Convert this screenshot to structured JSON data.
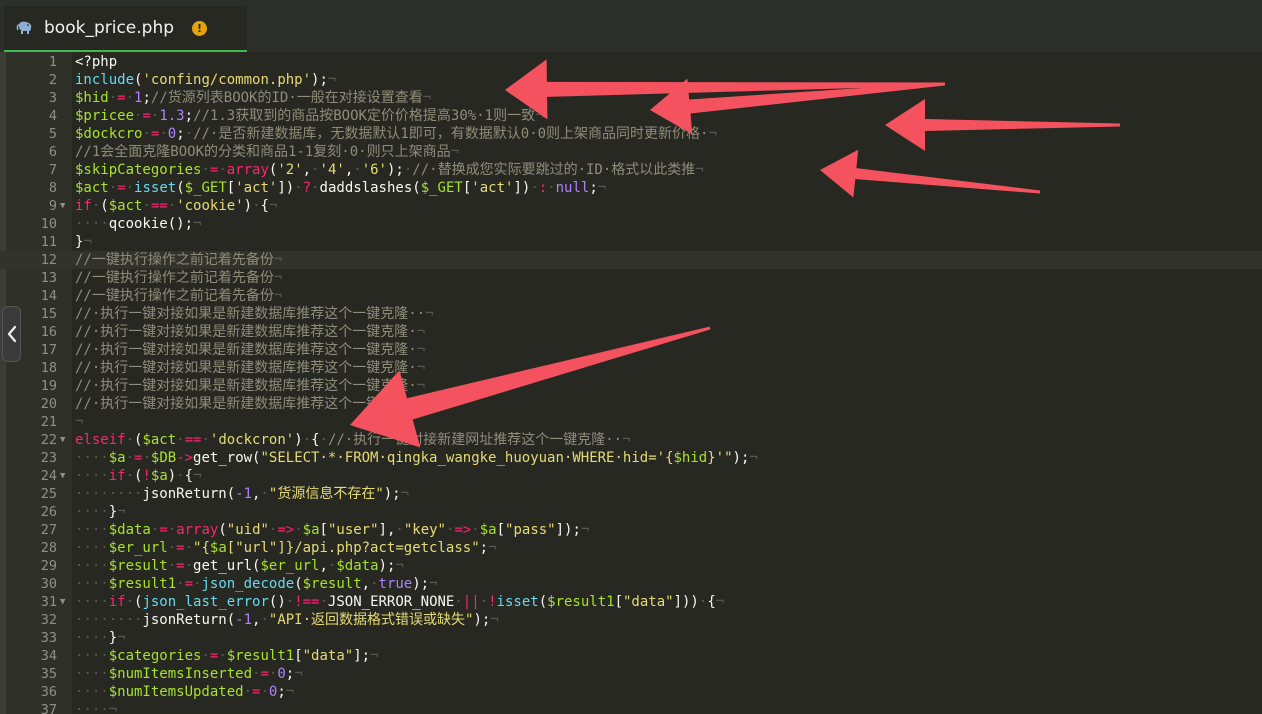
{
  "tab": {
    "icon": "php-elephant-icon",
    "title": "book_price.php",
    "warning_icon": "warning-icon",
    "warning_glyph": "!"
  },
  "side_handle": {
    "icon": "chevron-left-icon"
  },
  "editor": {
    "active_line": 12,
    "whitespace_marker": "¬",
    "lines": [
      {
        "n": "1",
        "t": [
          [
            "",
            "<?php"
          ]
        ]
      },
      {
        "n": "2",
        "t": [
          [
            "f",
            "include"
          ],
          [
            "",
            "("
          ],
          [
            "s",
            "'confing/common.php'"
          ],
          [
            "",
            ");"
          ],
          [
            "w",
            "¬"
          ]
        ]
      },
      {
        "n": "3",
        "t": [
          [
            "v",
            "$hid"
          ],
          [
            "w",
            "·"
          ],
          [
            "o",
            "="
          ],
          [
            "w",
            "·"
          ],
          [
            "n",
            "1"
          ],
          [
            "",
            ";"
          ],
          [
            "c",
            "//货源列表BOOK的ID·一般在对接设置查看"
          ],
          [
            "w",
            "¬"
          ]
        ]
      },
      {
        "n": "4",
        "t": [
          [
            "v",
            "$pricee"
          ],
          [
            "w",
            "·"
          ],
          [
            "o",
            "="
          ],
          [
            "w",
            "·"
          ],
          [
            "n",
            "1.3"
          ],
          [
            "",
            ";"
          ],
          [
            "c",
            "//1.3获取到的商品按BOOK定价价格提高30%·1则一致"
          ],
          [
            "w",
            "¬"
          ]
        ]
      },
      {
        "n": "5",
        "t": [
          [
            "v",
            "$dockcro"
          ],
          [
            "w",
            "·"
          ],
          [
            "o",
            "="
          ],
          [
            "w",
            "·"
          ],
          [
            "n",
            "0"
          ],
          [
            "",
            ";"
          ],
          [
            "w",
            "·"
          ],
          [
            "c",
            "//·是否新建数据库，无数据默认1即可，有数据默认0·0则上架商品同时更新价格·"
          ],
          [
            "w",
            "¬"
          ]
        ]
      },
      {
        "n": "6",
        "t": [
          [
            "c",
            "//1会全面克隆BOOK的分类和商品1-1复刻·0·则只上架商品"
          ],
          [
            "w",
            "¬"
          ]
        ]
      },
      {
        "n": "7",
        "t": [
          [
            "v",
            "$skipCategories"
          ],
          [
            "w",
            "·"
          ],
          [
            "o",
            "="
          ],
          [
            "w",
            "·"
          ],
          [
            "k",
            "array"
          ],
          [
            "",
            "("
          ],
          [
            "s",
            "'2'"
          ],
          [
            "",
            ","
          ],
          [
            "w",
            "·"
          ],
          [
            "s",
            "'4'"
          ],
          [
            "",
            ","
          ],
          [
            "w",
            "·"
          ],
          [
            "s",
            "'6'"
          ],
          [
            "",
            ");"
          ],
          [
            "w",
            "·"
          ],
          [
            "c",
            "//·替换成您实际要跳过的·ID·格式以此类推"
          ],
          [
            "w",
            "¬"
          ]
        ]
      },
      {
        "n": "8",
        "t": [
          [
            "v",
            "$act"
          ],
          [
            "w",
            "·"
          ],
          [
            "o",
            "="
          ],
          [
            "w",
            "·"
          ],
          [
            "f",
            "isset"
          ],
          [
            "",
            "("
          ],
          [
            "v",
            "$_GET"
          ],
          [
            "",
            "["
          ],
          [
            "s",
            "'act'"
          ],
          [
            "",
            "])"
          ],
          [
            "w",
            "·"
          ],
          [
            "o",
            "?"
          ],
          [
            "w",
            "·"
          ],
          [
            "",
            "daddslashes("
          ],
          [
            "v",
            "$_GET"
          ],
          [
            "",
            "["
          ],
          [
            "s",
            "'act'"
          ],
          [
            "",
            "])"
          ],
          [
            "w",
            "·"
          ],
          [
            "o",
            ":"
          ],
          [
            "w",
            "·"
          ],
          [
            "n",
            "null"
          ],
          [
            "",
            ";"
          ],
          [
            "w",
            "¬"
          ]
        ]
      },
      {
        "n": "9",
        "fold": true,
        "t": [
          [
            "k",
            "if"
          ],
          [
            "w",
            "·"
          ],
          [
            "",
            "("
          ],
          [
            "v",
            "$act"
          ],
          [
            "w",
            "·"
          ],
          [
            "o",
            "=="
          ],
          [
            "w",
            "·"
          ],
          [
            "s",
            "'cookie'"
          ],
          [
            "",
            ")"
          ],
          [
            "w",
            "·"
          ],
          [
            "",
            "{"
          ],
          [
            "w",
            "¬"
          ]
        ]
      },
      {
        "n": "10",
        "t": [
          [
            "w",
            "····"
          ],
          [
            "",
            "qcookie();"
          ],
          [
            "w",
            "¬"
          ]
        ]
      },
      {
        "n": "11",
        "t": [
          [
            "",
            "}"
          ],
          [
            "w",
            "¬"
          ]
        ]
      },
      {
        "n": "12",
        "t": [
          [
            "c",
            "//一键执行操作之前记着先备份"
          ],
          [
            "w",
            "¬"
          ]
        ]
      },
      {
        "n": "13",
        "t": [
          [
            "c",
            "//一键执行操作之前记着先备份"
          ],
          [
            "w",
            "¬"
          ]
        ]
      },
      {
        "n": "14",
        "t": [
          [
            "c",
            "//一键执行操作之前记着先备份"
          ],
          [
            "w",
            "¬"
          ]
        ]
      },
      {
        "n": "15",
        "t": [
          [
            "c",
            "//·执行一键对接如果是新建数据库推荐这个一键克隆··"
          ],
          [
            "w",
            "¬"
          ]
        ]
      },
      {
        "n": "16",
        "t": [
          [
            "c",
            "//·执行一键对接如果是新建数据库推荐这个一键克隆·"
          ],
          [
            "w",
            "¬"
          ]
        ]
      },
      {
        "n": "17",
        "t": [
          [
            "c",
            "//·执行一键对接如果是新建数据库推荐这个一键克隆·"
          ],
          [
            "w",
            "¬"
          ]
        ]
      },
      {
        "n": "18",
        "t": [
          [
            "c",
            "//·执行一键对接如果是新建数据库推荐这个一键克隆·"
          ],
          [
            "w",
            "¬"
          ]
        ]
      },
      {
        "n": "19",
        "t": [
          [
            "c",
            "//·执行一键对接如果是新建数据库推荐这个一键克隆·"
          ],
          [
            "w",
            "¬"
          ]
        ]
      },
      {
        "n": "20",
        "t": [
          [
            "c",
            "//·执行一键对接如果是新建数据库推荐这个一键克隆·"
          ],
          [
            "w",
            "¬"
          ]
        ]
      },
      {
        "n": "21",
        "t": [
          [
            "w",
            "¬"
          ]
        ]
      },
      {
        "n": "22",
        "fold": true,
        "t": [
          [
            "k",
            "elseif"
          ],
          [
            "w",
            "·"
          ],
          [
            "",
            "("
          ],
          [
            "v",
            "$act"
          ],
          [
            "w",
            "·"
          ],
          [
            "o",
            "=="
          ],
          [
            "w",
            "·"
          ],
          [
            "s",
            "'dockcron'"
          ],
          [
            "",
            ")"
          ],
          [
            "w",
            "·"
          ],
          [
            "",
            "{"
          ],
          [
            "w",
            "·"
          ],
          [
            "c",
            "//·执行一键对接新建网址推荐这个一键克隆··"
          ],
          [
            "w",
            "¬"
          ]
        ]
      },
      {
        "n": "23",
        "t": [
          [
            "w",
            "····"
          ],
          [
            "v",
            "$a"
          ],
          [
            "w",
            "·"
          ],
          [
            "o",
            "="
          ],
          [
            "w",
            "·"
          ],
          [
            "v",
            "$DB"
          ],
          [
            "o",
            "->"
          ],
          [
            "",
            "get_row("
          ],
          [
            "s",
            "\"SELECT·*·FROM·qingka_wangke_huoyuan·WHERE·hid='{"
          ],
          [
            "v",
            "$hid"
          ],
          [
            "s",
            "}'\""
          ],
          [
            "",
            ");"
          ],
          [
            "w",
            "¬"
          ]
        ]
      },
      {
        "n": "24",
        "fold": true,
        "t": [
          [
            "w",
            "····"
          ],
          [
            "k",
            "if"
          ],
          [
            "w",
            "·"
          ],
          [
            "",
            "("
          ],
          [
            "o",
            "!"
          ],
          [
            "v",
            "$a"
          ],
          [
            "",
            ")"
          ],
          [
            "w",
            "·"
          ],
          [
            "",
            "{"
          ],
          [
            "w",
            "¬"
          ]
        ]
      },
      {
        "n": "25",
        "t": [
          [
            "w",
            "········"
          ],
          [
            "",
            "jsonReturn("
          ],
          [
            "n",
            "-1"
          ],
          [
            "",
            ","
          ],
          [
            "w",
            "·"
          ],
          [
            "s",
            "\"货源信息不存在\""
          ],
          [
            "",
            ");"
          ],
          [
            "w",
            "¬"
          ]
        ]
      },
      {
        "n": "26",
        "t": [
          [
            "w",
            "····"
          ],
          [
            "",
            "}"
          ],
          [
            "w",
            "¬"
          ]
        ]
      },
      {
        "n": "27",
        "t": [
          [
            "w",
            "····"
          ],
          [
            "v",
            "$data"
          ],
          [
            "w",
            "·"
          ],
          [
            "o",
            "="
          ],
          [
            "w",
            "·"
          ],
          [
            "k",
            "array"
          ],
          [
            "",
            "("
          ],
          [
            "s",
            "\"uid\""
          ],
          [
            "w",
            "·"
          ],
          [
            "o",
            "=>"
          ],
          [
            "w",
            "·"
          ],
          [
            "v",
            "$a"
          ],
          [
            "",
            "["
          ],
          [
            "s",
            "\"user\""
          ],
          [
            "",
            "],"
          ],
          [
            "w",
            "·"
          ],
          [
            "s",
            "\"key\""
          ],
          [
            "w",
            "·"
          ],
          [
            "o",
            "=>"
          ],
          [
            "w",
            "·"
          ],
          [
            "v",
            "$a"
          ],
          [
            "",
            "["
          ],
          [
            "s",
            "\"pass\""
          ],
          [
            "",
            "]);"
          ],
          [
            "w",
            "¬"
          ]
        ]
      },
      {
        "n": "28",
        "t": [
          [
            "w",
            "····"
          ],
          [
            "v",
            "$er_url"
          ],
          [
            "w",
            "·"
          ],
          [
            "o",
            "="
          ],
          [
            "w",
            "·"
          ],
          [
            "s",
            "\"{"
          ],
          [
            "v",
            "$a"
          ],
          [
            "s",
            "[\"url\"]}/api.php?act=getclass\""
          ],
          [
            "",
            ";"
          ],
          [
            "w",
            "¬"
          ]
        ]
      },
      {
        "n": "29",
        "t": [
          [
            "w",
            "····"
          ],
          [
            "v",
            "$result"
          ],
          [
            "w",
            "·"
          ],
          [
            "o",
            "="
          ],
          [
            "w",
            "·"
          ],
          [
            "",
            "get_url("
          ],
          [
            "v",
            "$er_url"
          ],
          [
            "",
            ","
          ],
          [
            "w",
            "·"
          ],
          [
            "v",
            "$data"
          ],
          [
            "",
            ");"
          ],
          [
            "w",
            "¬"
          ]
        ]
      },
      {
        "n": "30",
        "t": [
          [
            "w",
            "····"
          ],
          [
            "v",
            "$result1"
          ],
          [
            "w",
            "·"
          ],
          [
            "o",
            "="
          ],
          [
            "w",
            "·"
          ],
          [
            "f",
            "json_decode"
          ],
          [
            "",
            "("
          ],
          [
            "v",
            "$result"
          ],
          [
            "",
            ","
          ],
          [
            "w",
            "·"
          ],
          [
            "n",
            "true"
          ],
          [
            "",
            ");"
          ],
          [
            "w",
            "¬"
          ]
        ]
      },
      {
        "n": "31",
        "fold": true,
        "t": [
          [
            "w",
            "····"
          ],
          [
            "k",
            "if"
          ],
          [
            "w",
            "·"
          ],
          [
            "",
            "("
          ],
          [
            "f",
            "json_last_error"
          ],
          [
            "",
            "()"
          ],
          [
            "w",
            "·"
          ],
          [
            "o",
            "!=="
          ],
          [
            "w",
            "·"
          ],
          [
            "",
            "JSON_ERROR_NONE"
          ],
          [
            "w",
            "·"
          ],
          [
            "o",
            "||"
          ],
          [
            "w",
            "·"
          ],
          [
            "o",
            "!"
          ],
          [
            "f",
            "isset"
          ],
          [
            "",
            "("
          ],
          [
            "v",
            "$result1"
          ],
          [
            "",
            "["
          ],
          [
            "s",
            "\"data\""
          ],
          [
            "",
            "]))"
          ],
          [
            "w",
            "·"
          ],
          [
            "",
            "{"
          ],
          [
            "w",
            "¬"
          ]
        ]
      },
      {
        "n": "32",
        "t": [
          [
            "w",
            "········"
          ],
          [
            "",
            "jsonReturn("
          ],
          [
            "n",
            "-1"
          ],
          [
            "",
            ","
          ],
          [
            "w",
            "·"
          ],
          [
            "s",
            "\"API·返回数据格式错误或缺失\""
          ],
          [
            "",
            ");"
          ],
          [
            "w",
            "¬"
          ]
        ]
      },
      {
        "n": "33",
        "t": [
          [
            "w",
            "····"
          ],
          [
            "",
            "}"
          ],
          [
            "w",
            "¬"
          ]
        ]
      },
      {
        "n": "34",
        "t": [
          [
            "w",
            "····"
          ],
          [
            "v",
            "$categories"
          ],
          [
            "w",
            "·"
          ],
          [
            "o",
            "="
          ],
          [
            "w",
            "·"
          ],
          [
            "v",
            "$result1"
          ],
          [
            "",
            "["
          ],
          [
            "s",
            "\"data\""
          ],
          [
            "",
            "];"
          ],
          [
            "w",
            "¬"
          ]
        ]
      },
      {
        "n": "35",
        "t": [
          [
            "w",
            "····"
          ],
          [
            "v",
            "$numItemsInserted"
          ],
          [
            "w",
            "·"
          ],
          [
            "o",
            "="
          ],
          [
            "w",
            "·"
          ],
          [
            "n",
            "0"
          ],
          [
            "",
            ";"
          ],
          [
            "w",
            "¬"
          ]
        ]
      },
      {
        "n": "36",
        "t": [
          [
            "w",
            "····"
          ],
          [
            "v",
            "$numItemsUpdated"
          ],
          [
            "w",
            "·"
          ],
          [
            "o",
            "="
          ],
          [
            "w",
            "·"
          ],
          [
            "n",
            "0"
          ],
          [
            "",
            ";"
          ],
          [
            "w",
            "¬"
          ]
        ]
      },
      {
        "n": "37",
        "t": [
          [
            "w",
            "····¬"
          ]
        ]
      }
    ]
  },
  "annotation_arrows": {
    "color": "#f5525f",
    "count": 5
  }
}
